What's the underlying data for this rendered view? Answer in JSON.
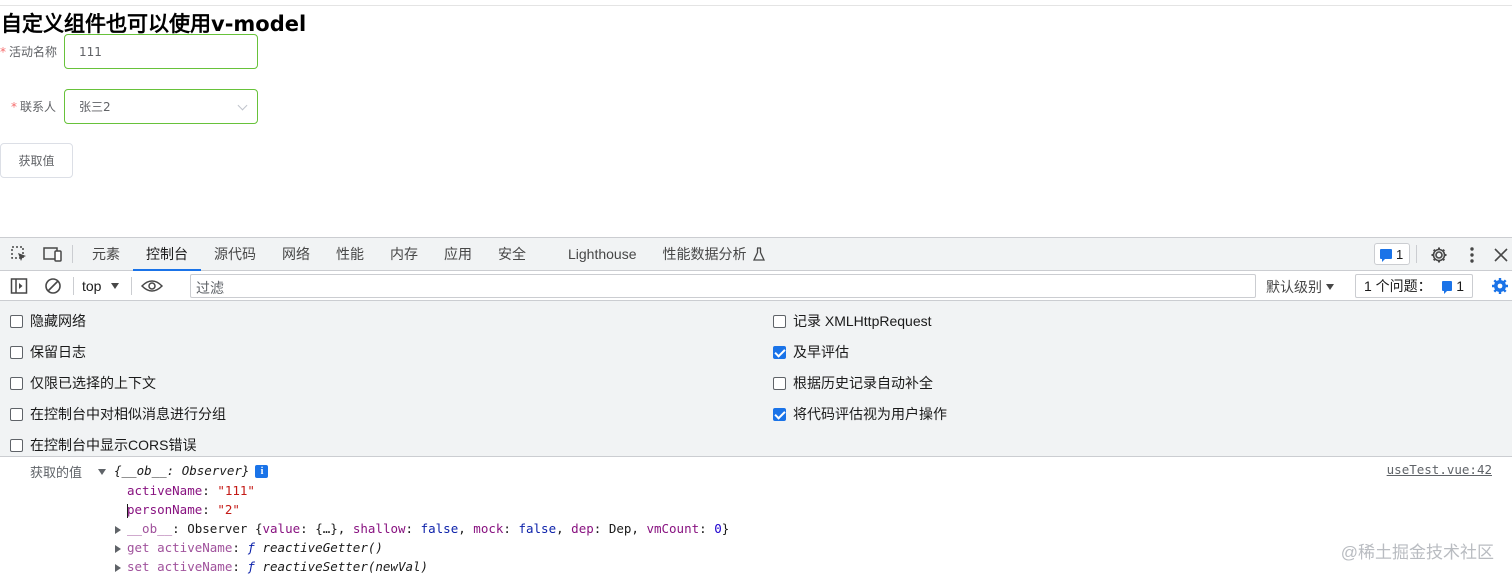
{
  "page": {
    "title": "自定义组件也可以使用v-model",
    "form": {
      "activity_label": "活动名称",
      "activity_value": "111",
      "contact_label": "联系人",
      "contact_value": "张三2",
      "required_mark": "*"
    },
    "get_button": "获取值"
  },
  "devtools": {
    "tabs": [
      "元素",
      "控制台",
      "源代码",
      "网络",
      "性能",
      "内存",
      "应用",
      "安全",
      "Lighthouse",
      "性能数据分析"
    ],
    "active_tab": "控制台",
    "issue_count": "1",
    "context": "top",
    "filter_placeholder": "过滤",
    "levels_label": "默认级别",
    "issues_label": "1 个问题：",
    "issues_count": "1",
    "settings": {
      "left": [
        {
          "label": "隐藏网络",
          "checked": false
        },
        {
          "label": "保留日志",
          "checked": false
        },
        {
          "label": "仅限已选择的上下文",
          "checked": false
        },
        {
          "label": "在控制台中对相似消息进行分组",
          "checked": false
        },
        {
          "label": "在控制台中显示CORS错误",
          "checked": false
        }
      ],
      "right": [
        {
          "label": "记录 XMLHttpRequest",
          "checked": false
        },
        {
          "label": "及早评估",
          "checked": true
        },
        {
          "label": "根据历史记录自动补全",
          "checked": false
        },
        {
          "label": "将代码评估视为用户操作",
          "checked": true
        }
      ]
    },
    "console": {
      "log_label": "获取的值",
      "object_summary": "{__ob__: Observer}",
      "info_badge": "i",
      "source": "useTest.vue:42",
      "activeName_key": "activeName",
      "activeName_value": "\"111\"",
      "personName_key": "personName",
      "personName_value": "\"2\"",
      "ob_key": "__ob__",
      "ob_type": "Observer",
      "ob_value_key": "value",
      "ob_value_val": "{…}",
      "ob_shallow_key": "shallow",
      "ob_shallow_val": "false",
      "ob_mock_key": "mock",
      "ob_mock_val": "false",
      "ob_dep_key": "dep",
      "ob_dep_val": "Dep",
      "ob_vm_key": "vmCount",
      "ob_vm_val": "0",
      "getter_key": "get activeName",
      "getter_fn": "reactiveGetter()",
      "setter_key": "set activeName",
      "setter_fn": "reactiveSetter(newVal)",
      "fn_symbol": "ƒ"
    },
    "watermark": "@稀土掘金技术社区"
  },
  "colors": {
    "input_border": "#67c23a",
    "required": "#f56c6c",
    "accent": "#1a73e8"
  }
}
